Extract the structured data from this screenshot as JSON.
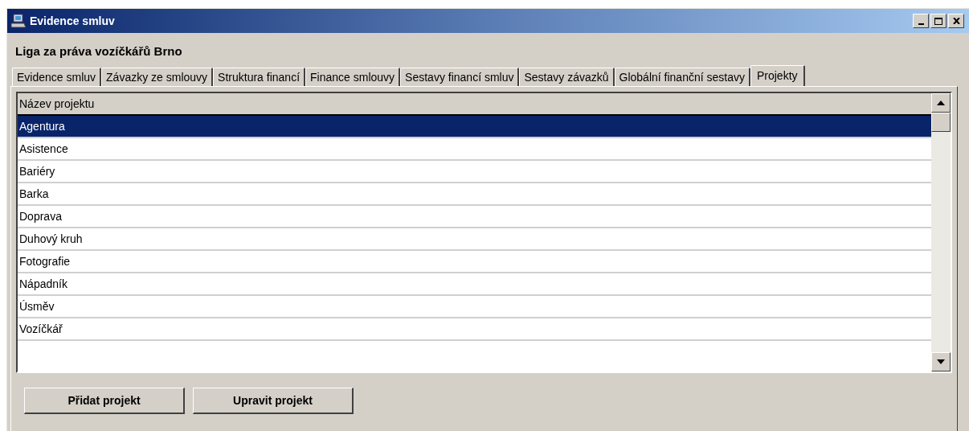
{
  "window": {
    "title": "Evidence smluv"
  },
  "organization": "Liga za práva vozíčkářů Brno",
  "tabs": [
    {
      "label": "Evidence smluv",
      "selected": false
    },
    {
      "label": "Závazky ze smlouvy",
      "selected": false
    },
    {
      "label": "Struktura financí",
      "selected": false
    },
    {
      "label": "Finance smlouvy",
      "selected": false
    },
    {
      "label": "Sestavy financí smluv",
      "selected": false
    },
    {
      "label": "Sestavy závazků",
      "selected": false
    },
    {
      "label": "Globální finanční sestavy",
      "selected": false
    },
    {
      "label": "Projekty",
      "selected": true
    }
  ],
  "table": {
    "columns": [
      "Název projektu"
    ],
    "rows": [
      {
        "name": "Agentura",
        "selected": true
      },
      {
        "name": "Asistence",
        "selected": false
      },
      {
        "name": "Bariéry",
        "selected": false
      },
      {
        "name": "Barka",
        "selected": false
      },
      {
        "name": "Doprava",
        "selected": false
      },
      {
        "name": "Duhový kruh",
        "selected": false
      },
      {
        "name": "Fotografie",
        "selected": false
      },
      {
        "name": "Nápadník",
        "selected": false
      },
      {
        "name": "Úsměv",
        "selected": false
      },
      {
        "name": "Vozíčkář",
        "selected": false
      }
    ]
  },
  "buttons": [
    "Přidat projekt",
    "Upravit projekt"
  ]
}
